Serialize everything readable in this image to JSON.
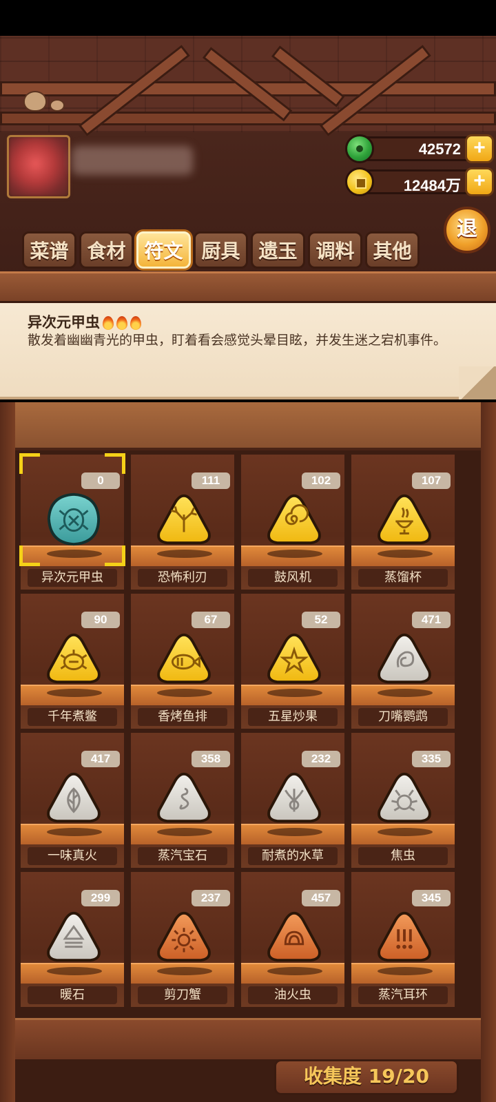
{
  "currencies": {
    "jade": {
      "icon": "jade-icon",
      "value": "42572"
    },
    "coins": {
      "icon": "coin-icon",
      "value": "12484万"
    }
  },
  "back_button": "退",
  "tabs": [
    {
      "label": "菜谱",
      "active": false
    },
    {
      "label": "食材",
      "active": false
    },
    {
      "label": "符文",
      "active": true
    },
    {
      "label": "厨具",
      "active": false
    },
    {
      "label": "遗玉",
      "active": false
    },
    {
      "label": "调料",
      "active": false
    },
    {
      "label": "其他",
      "active": false
    }
  ],
  "selected": {
    "title": "异次元甲虫",
    "rarity_flames": 3,
    "description": "散发着幽幽青光的甲虫，盯着看会感觉头晕目眩，并发生迷之宕机事件。"
  },
  "runes": [
    {
      "name": "异次元甲虫",
      "count": "0",
      "color": "teal",
      "glyph": "beetle",
      "selected": true
    },
    {
      "name": "恐怖利刃",
      "count": "111",
      "color": "gold",
      "glyph": "claw"
    },
    {
      "name": "鼓风机",
      "count": "102",
      "color": "gold",
      "glyph": "spiral"
    },
    {
      "name": "蒸馏杯",
      "count": "107",
      "color": "gold",
      "glyph": "cup"
    },
    {
      "name": "千年煮鳖",
      "count": "90",
      "color": "gold",
      "glyph": "turtle"
    },
    {
      "name": "香烤鱼排",
      "count": "67",
      "color": "gold",
      "glyph": "fish"
    },
    {
      "name": "五星炒果",
      "count": "52",
      "color": "gold",
      "glyph": "star"
    },
    {
      "name": "刀嘴鹦鹉",
      "count": "471",
      "color": "white",
      "glyph": "bird"
    },
    {
      "name": "一味真火",
      "count": "417",
      "color": "white",
      "glyph": "leaf"
    },
    {
      "name": "蒸汽宝石",
      "count": "358",
      "color": "white",
      "glyph": "snake"
    },
    {
      "name": "耐煮的水草",
      "count": "232",
      "color": "white",
      "glyph": "weed"
    },
    {
      "name": "焦虫",
      "count": "335",
      "color": "white",
      "glyph": "bug"
    },
    {
      "name": "暖石",
      "count": "299",
      "color": "white",
      "glyph": "waves"
    },
    {
      "name": "剪刀蟹",
      "count": "237",
      "color": "orange",
      "glyph": "crab"
    },
    {
      "name": "油火虫",
      "count": "457",
      "color": "orange",
      "glyph": "shell"
    },
    {
      "name": "蒸汽耳环",
      "count": "345",
      "color": "orange",
      "glyph": "marks"
    }
  ],
  "collection": "收集度 19/20",
  "colors": {
    "teal": "#4fb3b3",
    "gold": "#f5c518",
    "white": "#d9d6d0",
    "orange": "#d9743a",
    "accent": "#f5d118"
  }
}
